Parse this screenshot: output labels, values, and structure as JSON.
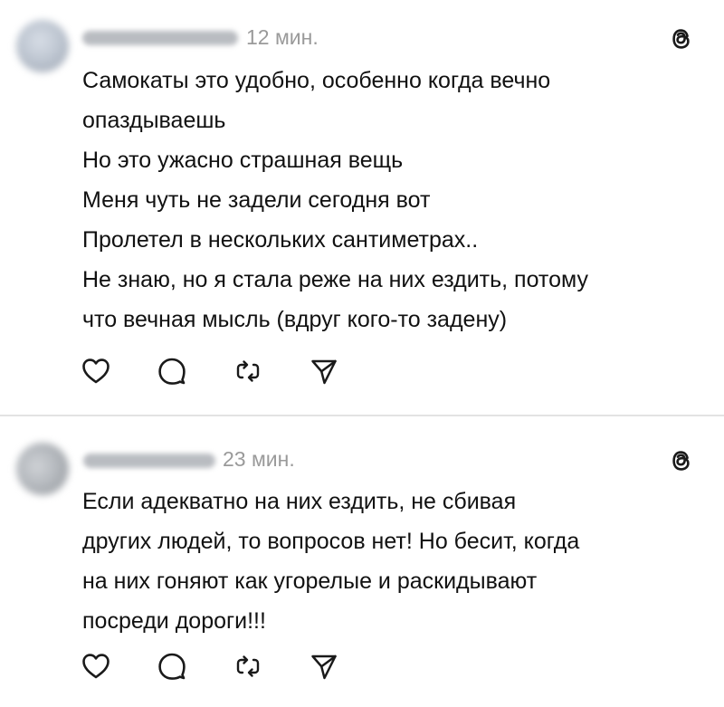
{
  "posts": [
    {
      "username": "rrlipencevva",
      "time": "12 мин.",
      "lines": [
        "Самокаты это удобно, особенно когда вечно",
        "опаздываешь",
        "Но это ужасно страшная вещь",
        "Меня чуть не задели сегодня вот",
        "Пролетел в нескольких сантиметрах..",
        "Не знаю, но я стала реже на них ездить, потому",
        "что вечная мысль (вдруг кого-то задену)"
      ]
    },
    {
      "username": "ssykoenyu",
      "time": "23 мин.",
      "lines": [
        "Если адекватно на них ездить, не сбивая",
        "других людей, то вопросов нет! Но бесит, когда",
        "на них гоняют как угорелые и раскидывают",
        "посреди дороги!!!"
      ]
    }
  ],
  "icons": {
    "threads": "threads-logo-icon",
    "like": "heart-icon",
    "comment": "comment-bubble-icon",
    "repost": "repost-icon",
    "share": "send-icon"
  },
  "colors": {
    "text": "#111111",
    "time": "#9a9a9a",
    "divider": "#e3e3e3",
    "icon": "#1a1a1a"
  }
}
